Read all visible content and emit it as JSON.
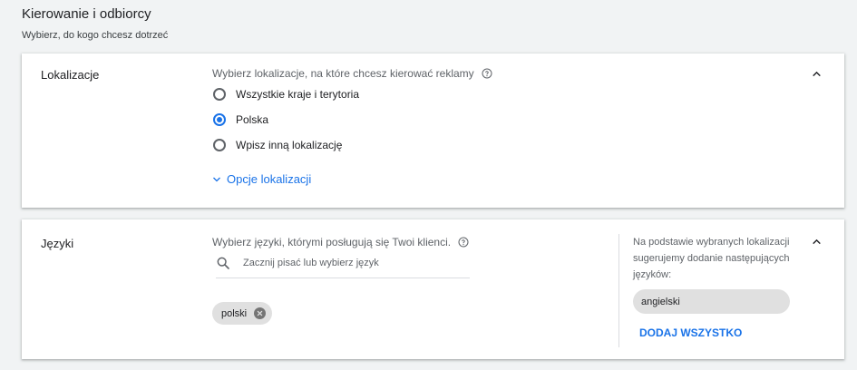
{
  "header": {
    "title": "Kierowanie i odbiorcy",
    "subtitle": "Wybierz, do kogo chcesz dotrzeć"
  },
  "locations": {
    "title": "Lokalizacje",
    "prompt": "Wybierz lokalizacje, na które chcesz kierować reklamy",
    "options": [
      {
        "label": "Wszystkie kraje i terytoria",
        "checked": false
      },
      {
        "label": "Polska",
        "checked": true
      },
      {
        "label": "Wpisz inną lokalizację",
        "checked": false
      }
    ],
    "options_link": "Opcje lokalizacji"
  },
  "languages": {
    "title": "Języki",
    "prompt": "Wybierz języki, którymi posługują się Twoi klienci.",
    "search_placeholder": "Zacznij pisać lub wybierz język",
    "selected": [
      "polski"
    ],
    "suggestion_text": "Na podstawie wybranych lokalizacji sugerujemy dodanie następujących języków:",
    "suggested": [
      "angielski"
    ],
    "add_all": "DODAJ WSZYSTKO"
  },
  "colors": {
    "accent": "#1a73e8",
    "background": "#f1f3f4",
    "chip": "#e0e0e0"
  },
  "icons": [
    "help-icon",
    "chevron-up-icon",
    "chevron-down-icon",
    "search-icon",
    "close-circle-icon"
  ]
}
